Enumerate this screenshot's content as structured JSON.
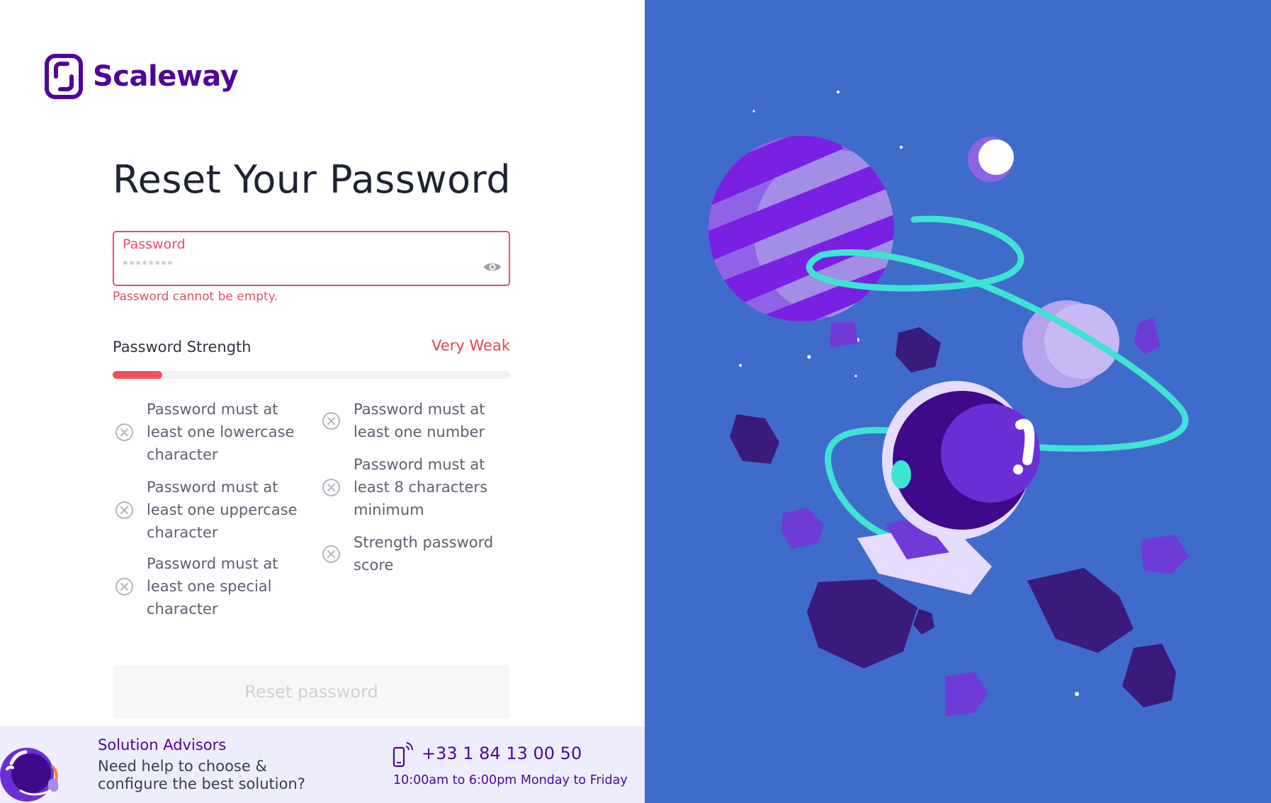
{
  "brand": {
    "name": "Scaleway",
    "color": "#4f0599"
  },
  "page": {
    "title": "Reset Your Password"
  },
  "password_field": {
    "label": "Password",
    "placeholder": "********",
    "value": "",
    "error": "Password cannot be empty.",
    "toggle_icon": "eye-icon"
  },
  "strength": {
    "label": "Password Strength",
    "value": "Very Weak",
    "level_fraction": 0.125,
    "color": "#f0505e"
  },
  "rules": [
    {
      "text": "Password must at least one lowercase character",
      "met": false,
      "icon": "x-circle-icon"
    },
    {
      "text": "Password must at least one number",
      "met": false,
      "icon": "x-circle-icon"
    },
    {
      "text": "Password must at least 8 characters minimum",
      "met": false,
      "icon": "x-circle-icon"
    },
    {
      "text": "Password must at least one uppercase character",
      "met": false,
      "icon": "x-circle-icon"
    },
    {
      "text": "Strength password score",
      "met": false,
      "icon": "x-circle-icon"
    },
    {
      "text": "Password must at least one special character",
      "met": false,
      "icon": "x-circle-icon"
    }
  ],
  "submit": {
    "label": "Reset password",
    "disabled": true
  },
  "footer": {
    "title": "Solution Advisors",
    "description": "Need help to choose & configure the best solution?",
    "phone": "+33 1 84 13 00 50",
    "hours": "10:00am to 6:00pm Monday to Friday",
    "phone_icon": "mobile-phone-icon"
  },
  "colors": {
    "accent": "#4f0599",
    "error": "#e4506b",
    "illustration_bg": "#3f6bcb"
  }
}
